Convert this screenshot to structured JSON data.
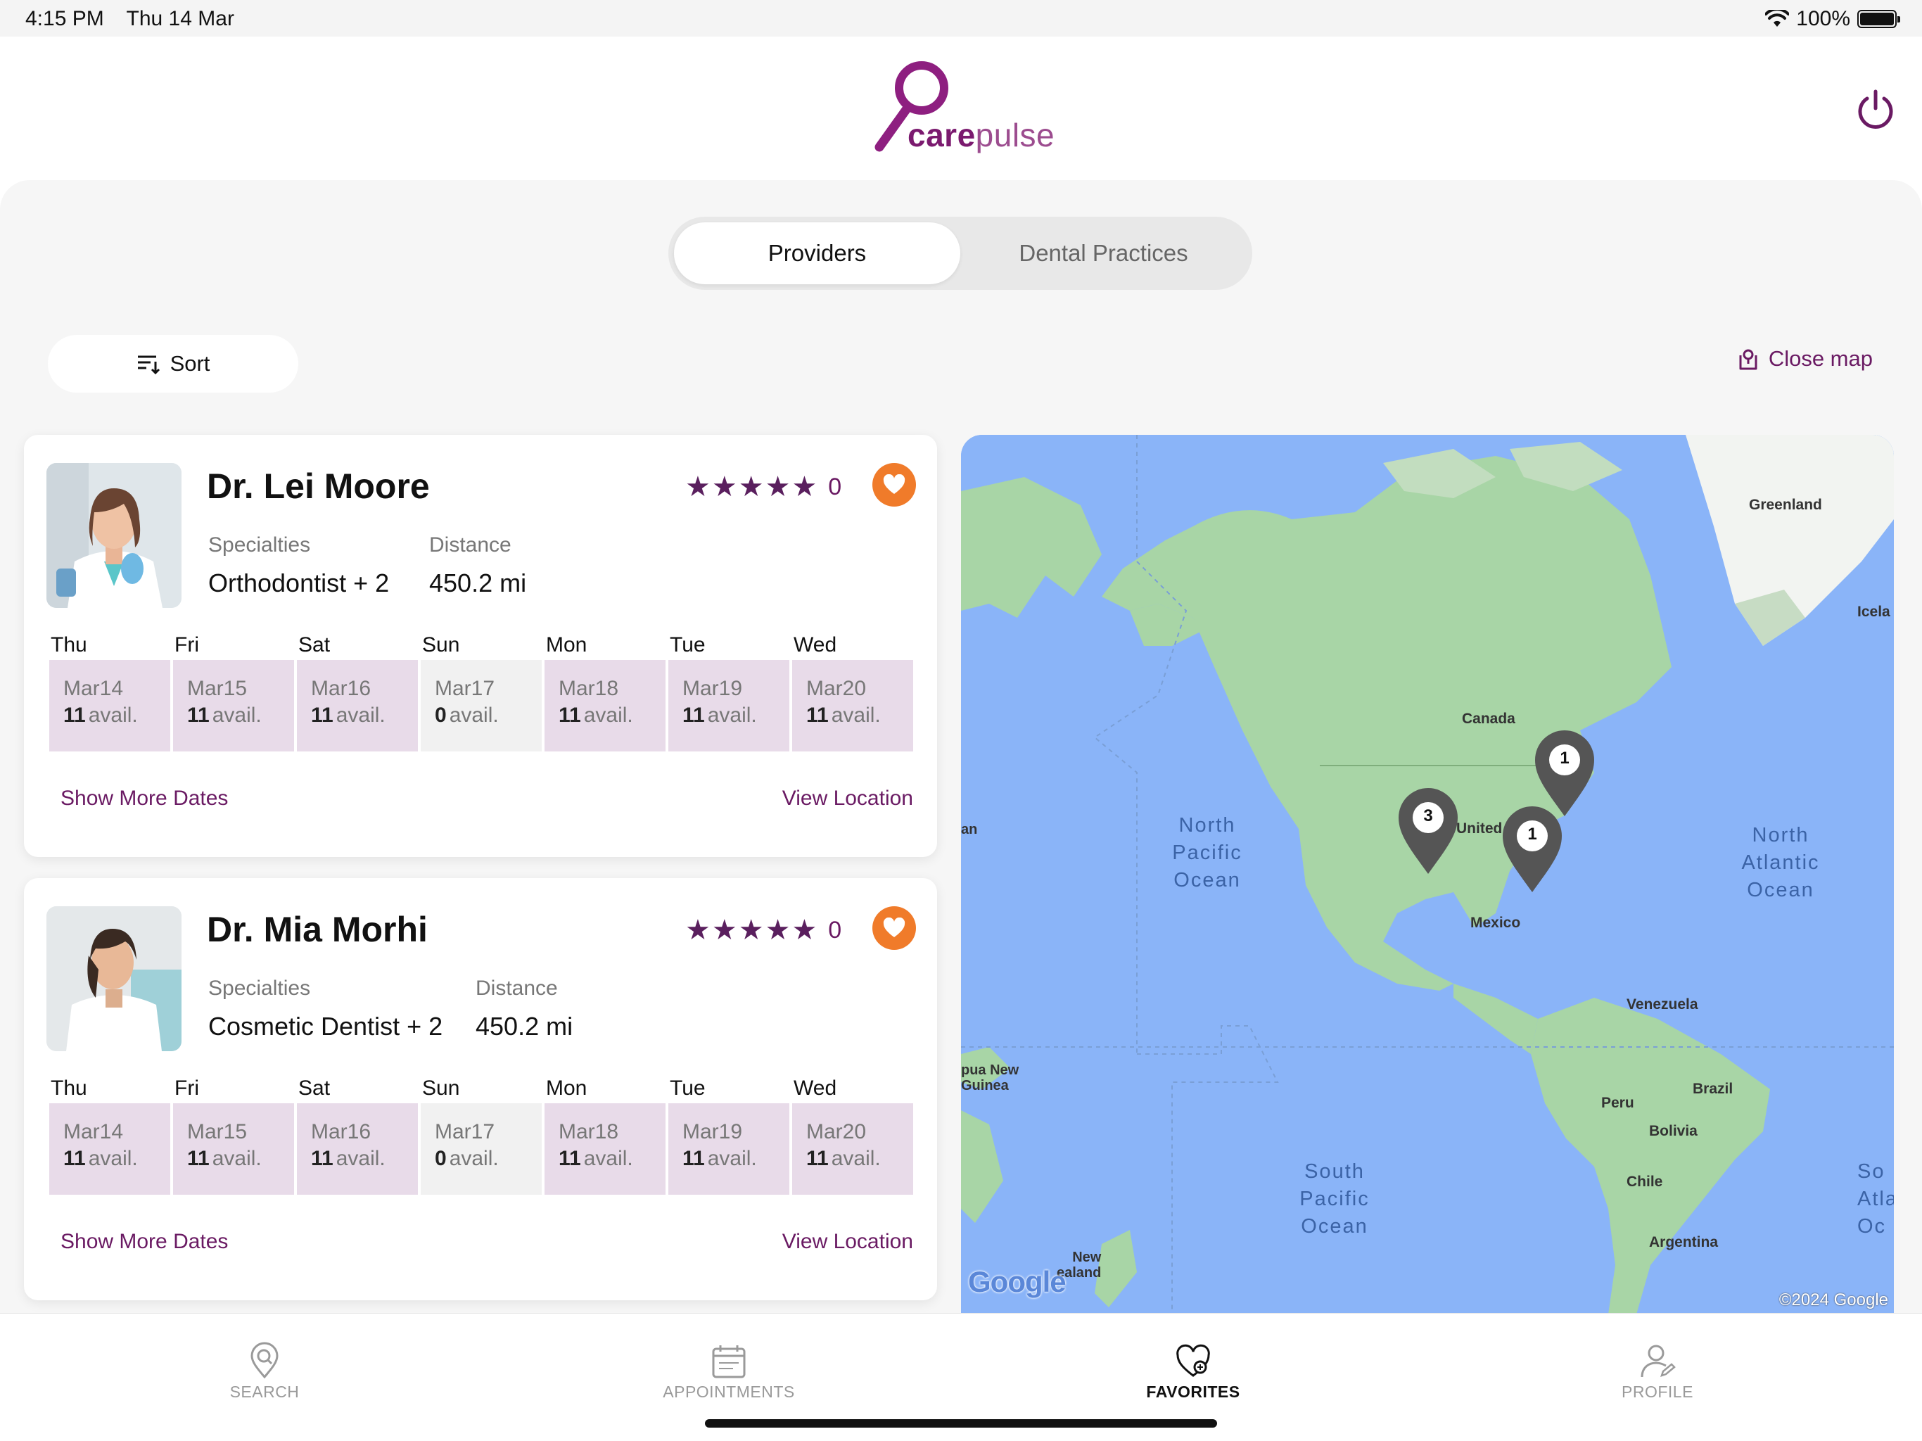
{
  "status_bar": {
    "time": "4:15 PM",
    "date": "Thu 14 Mar",
    "battery": "100%"
  },
  "header": {
    "logo_bold": "care",
    "logo_light": "pulse"
  },
  "segmented": {
    "tabs": [
      {
        "label": "Providers",
        "active": true
      },
      {
        "label": "Dental Practices",
        "active": false
      }
    ]
  },
  "toolbar": {
    "sort_label": "Sort",
    "close_map_label": "Close map"
  },
  "providers": [
    {
      "name": "Dr. Lei Moore",
      "rating_count": "0",
      "specialties_label": "Specialties",
      "specialties_value": "Orthodontist + 2",
      "distance_label": "Distance",
      "distance_value": "450.2 mi",
      "days": [
        {
          "day": "Thu",
          "date": "Mar14",
          "count": "11",
          "avail": "avail."
        },
        {
          "day": "Fri",
          "date": "Mar15",
          "count": "11",
          "avail": "avail."
        },
        {
          "day": "Sat",
          "date": "Mar16",
          "count": "11",
          "avail": "avail."
        },
        {
          "day": "Sun",
          "date": "Mar17",
          "count": "0",
          "avail": "avail."
        },
        {
          "day": "Mon",
          "date": "Mar18",
          "count": "11",
          "avail": "avail."
        },
        {
          "day": "Tue",
          "date": "Mar19",
          "count": "11",
          "avail": "avail."
        },
        {
          "day": "Wed",
          "date": "Mar20",
          "count": "11",
          "avail": "avail."
        }
      ],
      "show_more": "Show More Dates",
      "view_location": "View Location"
    },
    {
      "name": "Dr. Mia Morhi",
      "rating_count": "0",
      "specialties_label": "Specialties",
      "specialties_value": "Cosmetic Dentist + 2",
      "distance_label": "Distance",
      "distance_value": "450.2 mi",
      "days": [
        {
          "day": "Thu",
          "date": "Mar14",
          "count": "11",
          "avail": "avail."
        },
        {
          "day": "Fri",
          "date": "Mar15",
          "count": "11",
          "avail": "avail."
        },
        {
          "day": "Sat",
          "date": "Mar16",
          "count": "11",
          "avail": "avail."
        },
        {
          "day": "Sun",
          "date": "Mar17",
          "count": "0",
          "avail": "avail."
        },
        {
          "day": "Mon",
          "date": "Mar18",
          "count": "11",
          "avail": "avail."
        },
        {
          "day": "Tue",
          "date": "Mar19",
          "count": "11",
          "avail": "avail."
        },
        {
          "day": "Wed",
          "date": "Mar20",
          "count": "11",
          "avail": "avail."
        }
      ],
      "show_more": "Show More Dates",
      "view_location": "View Location"
    }
  ],
  "map": {
    "labels": {
      "greenland": "Greenland",
      "iceland": "Icela",
      "canada": "Canada",
      "united": "United",
      "mexico": "Mexico",
      "venezuela": "Venezuela",
      "peru": "Peru",
      "brazil": "Brazil",
      "bolivia": "Bolivia",
      "chile": "Chile",
      "argentina": "Argentina",
      "png1": "pua New",
      "png2": "Guinea",
      "nz1": "New",
      "nz2": "ealand",
      "an": "an"
    },
    "ocean_labels": {
      "npo": [
        "North",
        "Pacific",
        "Ocean"
      ],
      "nao": [
        "North",
        "Atlantic",
        "Ocean"
      ],
      "spo": [
        "South",
        "Pacific",
        "Ocean"
      ],
      "sao": [
        "So",
        "Atla",
        "Oc"
      ]
    },
    "markers": {
      "west": "3",
      "central": "1",
      "northeast": "1"
    },
    "google_logo": "Google",
    "copyright": "©2024 Google"
  },
  "bottom_nav": [
    {
      "label": "SEARCH",
      "icon": "search-location-icon",
      "active": false
    },
    {
      "label": "APPOINTMENTS",
      "icon": "calendar-icon",
      "active": false
    },
    {
      "label": "FAVORITES",
      "icon": "heart-icon",
      "active": true
    },
    {
      "label": "PROFILE",
      "icon": "profile-icon",
      "active": false
    }
  ],
  "colors": {
    "brand": "#7b1a6f",
    "accent": "#f07b2a",
    "slot": "#e8dbe9",
    "map_water": "#8ab4f8",
    "map_land": "#a8d5a6"
  }
}
